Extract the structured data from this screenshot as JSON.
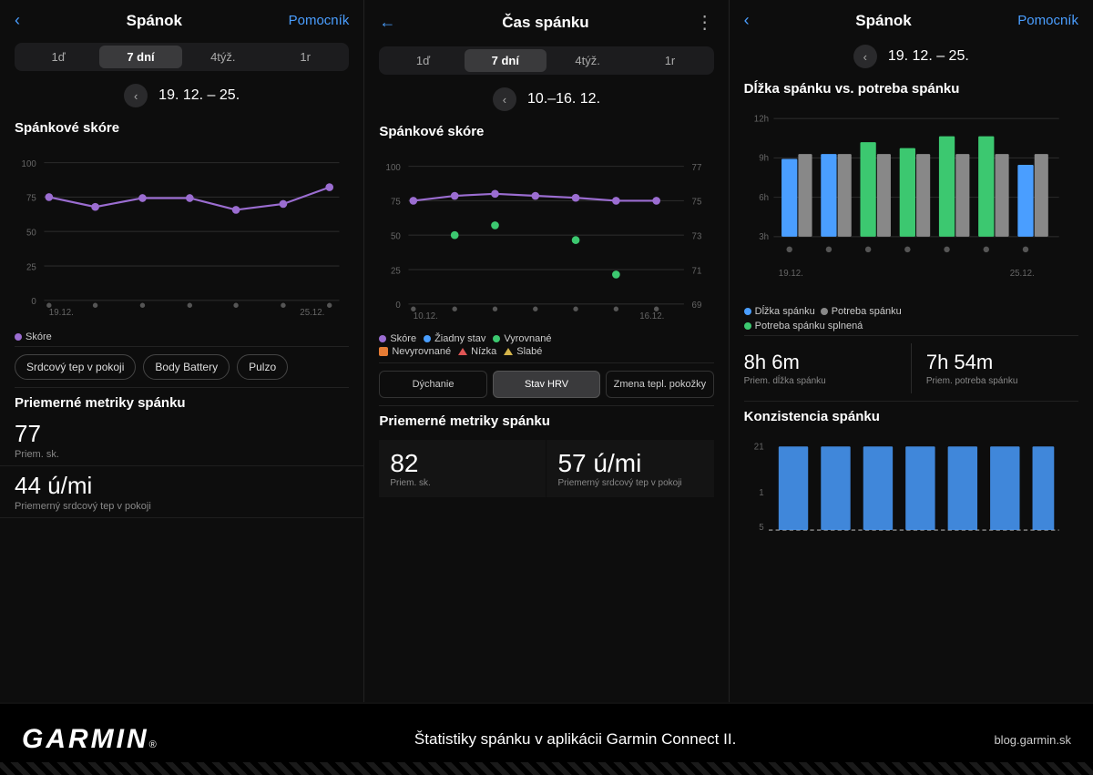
{
  "screens": [
    {
      "id": "screen1",
      "header": {
        "back_icon": "‹",
        "title": "Spánok",
        "action": "Pomocník"
      },
      "period_tabs": [
        "1ď",
        "7 dní",
        "4týž.",
        "1r"
      ],
      "active_tab": 1,
      "date_range": "19. 12. – 25.",
      "sections": [
        {
          "type": "line_chart",
          "title": "Spánkové skóre",
          "y_labels": [
            "100",
            "75",
            "50",
            "25",
            "0"
          ],
          "x_labels": [
            "19.12.",
            "25.12."
          ],
          "legend": [
            {
              "color": "purple",
              "label": "Skóre"
            }
          ],
          "data_points": [
            75,
            68,
            74,
            74,
            66,
            70,
            82
          ]
        }
      ],
      "metric_buttons": [
        "Srdcový tep v pokoji",
        "Body Battery",
        "Pulzo"
      ],
      "avg_section": {
        "title": "Priemerné metriky spánku",
        "metrics": [
          {
            "value": "77",
            "label": "Priem. sk."
          },
          {
            "value": "44 ú/mi",
            "label": "Priemerný srdcový tep v pokoji"
          }
        ]
      }
    },
    {
      "id": "screen2",
      "header": {
        "back_icon": "←",
        "title": "Čas spánku",
        "more_icon": "⋮"
      },
      "period_tabs": [
        "1ď",
        "7 dní",
        "4týž.",
        "1r"
      ],
      "active_tab": 1,
      "date_range": "10.–16. 12.",
      "sections": [
        {
          "type": "line_chart",
          "title": "Spánkové skóre",
          "y_labels": [
            "100",
            "75",
            "50",
            "25",
            "0"
          ],
          "right_labels": [
            "77",
            "75",
            "73",
            "71",
            "69"
          ],
          "x_labels": [
            "10.12.",
            "16.12."
          ],
          "data_points": [
            75,
            79,
            80,
            79,
            78,
            75,
            75
          ]
        }
      ],
      "legend_items": [
        {
          "type": "dot",
          "color": "purple",
          "label": "Skóre"
        },
        {
          "type": "dot",
          "color": "blue",
          "label": "Žiadny stav"
        },
        {
          "type": "dot",
          "color": "green",
          "label": "Vyrovnané"
        },
        {
          "type": "square",
          "color": "orange",
          "label": "Nevyrovnané"
        },
        {
          "type": "triangle",
          "color": "red",
          "label": "Nízka"
        },
        {
          "type": "triangle",
          "color": "yellow",
          "label": "Slabé"
        }
      ],
      "tab_buttons": [
        "Dýchanie",
        "Stav HRV",
        "Zmena tepl. pokožky"
      ],
      "active_tab_btn": 1,
      "avg_section": {
        "title": "Priemerné metriky spánku",
        "metrics": [
          {
            "value": "82",
            "label": "Priem. sk."
          },
          {
            "value": "57 ú/mi",
            "label": "Priemerný srdcový tep v pokoji"
          }
        ]
      }
    },
    {
      "id": "screen3",
      "header": {
        "back_icon": "‹",
        "title": "Spánok",
        "action": "Pomocník"
      },
      "period_nav": {
        "btn": "‹",
        "range": "19. 12. – 25."
      },
      "sleep_vs_need": {
        "title": "Dĺžka spánku vs. potreba spánku",
        "y_labels": [
          "12h",
          "9h",
          "6h",
          "3h"
        ],
        "x_labels": [
          "19.12.",
          "25.12."
        ],
        "legend": [
          {
            "color": "blue",
            "label": "Dĺžka spánku"
          },
          {
            "color": "gray",
            "label": "Potreba spánku"
          },
          {
            "color": "green",
            "label": "Potreba spánku splnená"
          }
        ]
      },
      "stats": [
        {
          "value": "8h 6m",
          "label": "Priem. dĺžka spánku"
        },
        {
          "value": "7h 54m",
          "label": "Priem. potreba spánku"
        }
      ],
      "consistency": {
        "title": "Konzistencia spánku",
        "y_labels": [
          "21",
          "1",
          "5"
        ],
        "bars": [
          1,
          1,
          1,
          1,
          1,
          1,
          1
        ]
      }
    }
  ],
  "footer": {
    "logo": "GARMIN",
    "reg_symbol": "®",
    "tagline": "Štatistiky spánku v aplikácii Garmin Connect II.",
    "url": "blog.garmin.sk"
  }
}
